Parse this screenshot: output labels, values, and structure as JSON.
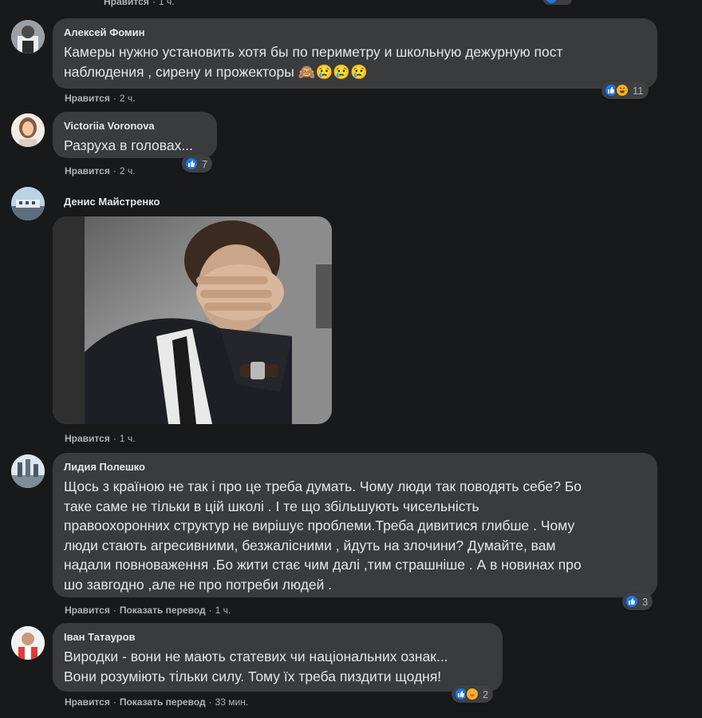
{
  "actions": {
    "like": "Нравится",
    "translate": "Показать перевод"
  },
  "top_meta": {
    "time": "1 ч."
  },
  "comments": [
    {
      "author": "Алексей Фомин",
      "lines": [
        "Камеры нужно установить хотя бы по периметру и школьную дежурную пост",
        "наблюдения , сирену и прожекторы 🙈😢😢😢"
      ],
      "time": "2 ч.",
      "reaction_count": "11",
      "reaction_icons": [
        "like-icon",
        "haha-icon"
      ]
    },
    {
      "author": "Victoriia Voronova",
      "lines": [
        "Разруха в головах..."
      ],
      "time": "2 ч.",
      "reaction_count": "7",
      "reaction_icons": [
        "like-icon"
      ]
    },
    {
      "author": "Денис Майстренко",
      "lines": [],
      "time": "1 ч.",
      "image": "gif-facepalm-man"
    },
    {
      "author": "Лидия Полешко",
      "lines": [
        "Щось з країною не так і про це треба думать. Чому люди так поводять себе? Бо",
        "таке саме не тільки в цій школі . І те що збільшують чисельність",
        "правоохоронних структур не вирішує проблеми.Треба дивитися глибше . Чому",
        "люди стають агресивними, безжалісними , йдуть на злочини? Думайте, вам",
        "надали повноваження .Бо жити стає чим далі ,тим страшніше . А в новинах про",
        "шо завгодно ,але не про потреби людей ."
      ],
      "time": "1 ч.",
      "reaction_count": "3",
      "reaction_icons": [
        "like-icon"
      ]
    },
    {
      "author": "Іван Татауров",
      "lines": [
        "Виродки - вони не мають статевих чи національних ознак...",
        "Вони розуміють тільки силу. Тому їх треба пиздити щодня!"
      ],
      "time": "33 мин.",
      "reaction_count": "2",
      "reaction_icons": [
        "like-icon",
        "care-icon"
      ]
    }
  ]
}
